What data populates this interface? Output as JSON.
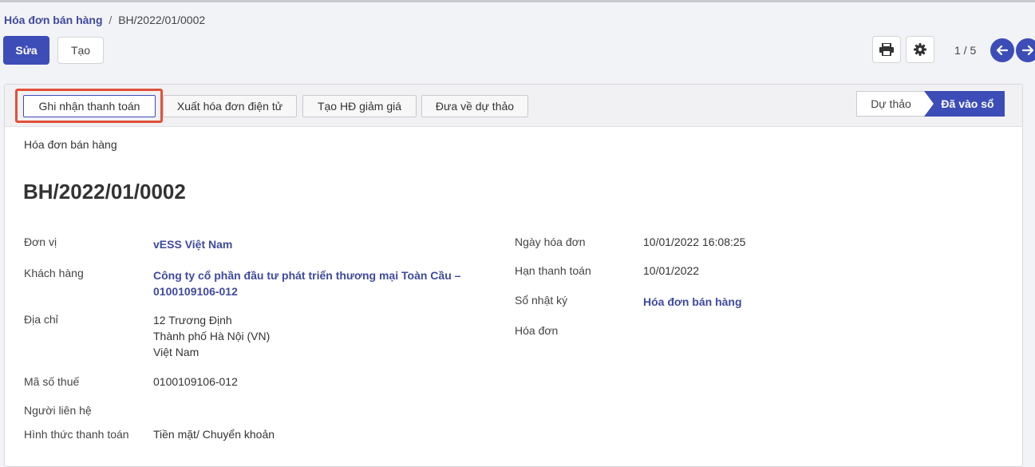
{
  "breadcrumb": {
    "parent": "Hóa đơn bán hàng",
    "separator": "/",
    "current": "BH/2022/01/0002"
  },
  "toolbar": {
    "edit_label": "Sửa",
    "create_label": "Tạo",
    "pager": "1 / 5"
  },
  "actions": {
    "record_payment": "Ghi nhận thanh toán",
    "issue_einvoice": "Xuất hóa đơn điện tử",
    "create_discount": "Tạo HĐ giảm giá",
    "reset_draft": "Đưa về dự thảo"
  },
  "status": {
    "draft": "Dự thảo",
    "posted": "Đã vào sổ",
    "active": "posted"
  },
  "form": {
    "doc_type": "Hóa đơn bán hàng",
    "number": "BH/2022/01/0002",
    "left": {
      "unit_label": "Đơn vị",
      "unit_value": "vESS Việt Nam",
      "customer_label": "Khách hàng",
      "customer_value_line1": "Công ty cổ phần đầu tư phát triển thương mại Toàn Cầu –",
      "customer_value_line2": "0100109106-012",
      "address_label": "Địa chỉ",
      "address_line1": "12 Trương Định",
      "address_line2": "Thành phố Hà Nội (VN)",
      "address_line3": "Việt Nam",
      "tax_label": "Mã số thuế",
      "tax_value": "0100109106-012",
      "contact_label": "Người liên hệ",
      "payment_method_label": "Hình thức thanh toán",
      "payment_method_value": "Tiền mặt/ Chuyển khoản"
    },
    "right": {
      "invoice_date_label": "Ngày hóa đơn",
      "invoice_date_value": "10/01/2022 16:08:25",
      "due_date_label": "Hạn thanh toán",
      "due_date_value": "10/01/2022",
      "journal_label": "Sổ nhật ký",
      "journal_value": "Hóa đơn bán hàng",
      "invoice_label": "Hóa đơn"
    }
  },
  "colors": {
    "primary": "#3d4db7",
    "link": "#3f4a9e",
    "highlight": "#e2513a"
  },
  "icons": [
    "print-icon",
    "gear-icon",
    "arrow-left-icon",
    "arrow-right-icon"
  ]
}
